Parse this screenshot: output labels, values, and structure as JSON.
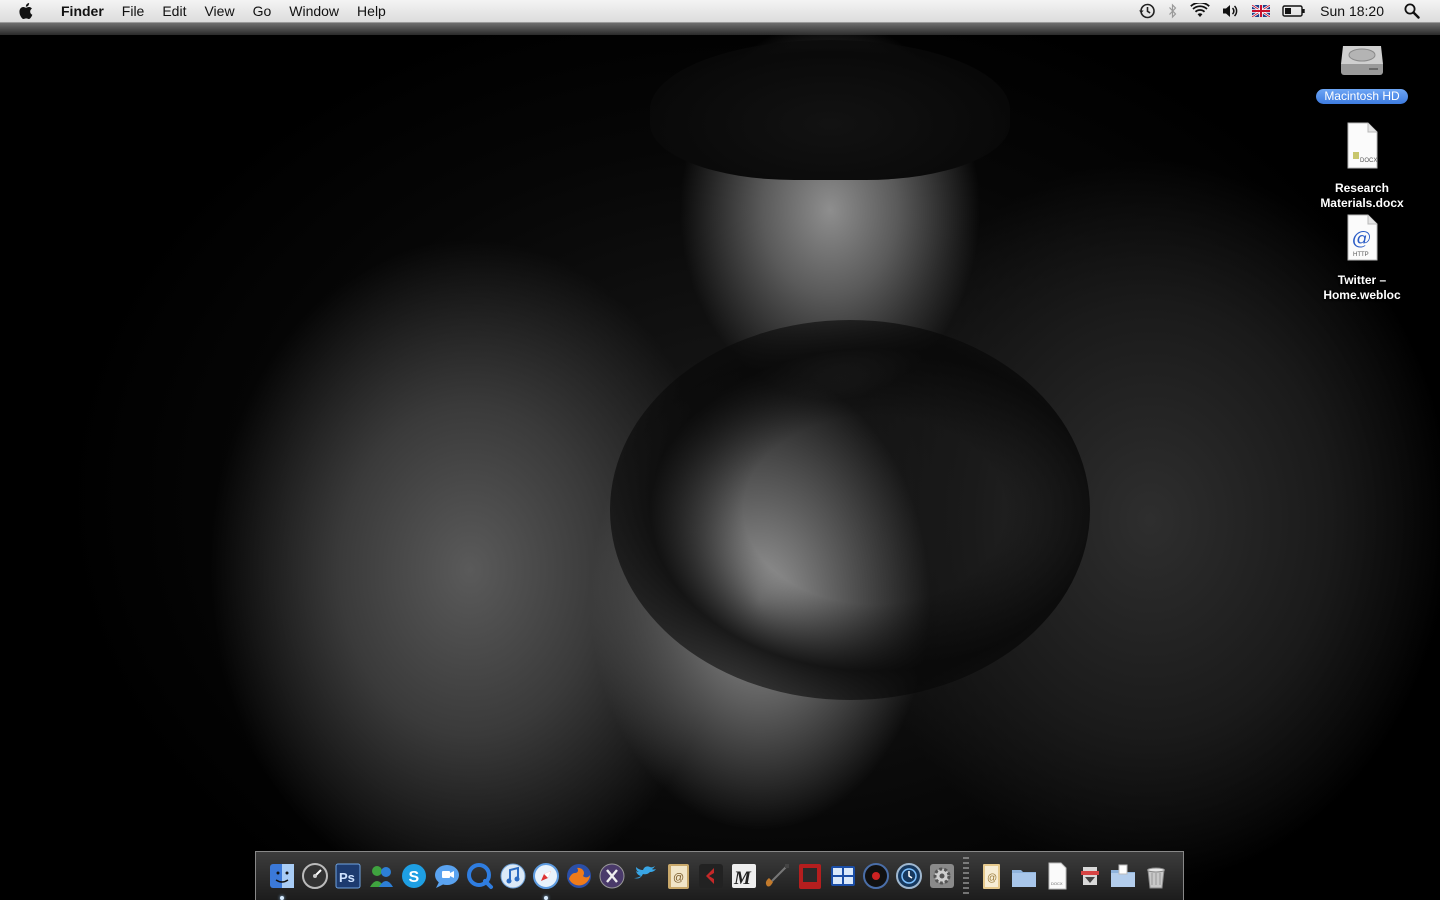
{
  "menubar": {
    "app_name": "Finder",
    "menus": [
      "File",
      "Edit",
      "View",
      "Go",
      "Window",
      "Help"
    ],
    "status_icons": [
      "time-machine-icon",
      "bluetooth-icon",
      "wifi-icon",
      "volume-icon",
      "uk-flag-icon",
      "battery-icon"
    ],
    "clock": "Sun 18:20"
  },
  "desktop_icons": [
    {
      "label": "Macintosh HD",
      "icon": "hard-drive-icon",
      "selected": true
    },
    {
      "label": "Research\nMaterials.docx",
      "icon": "docx-document-icon",
      "selected": false
    },
    {
      "label": "Twitter –\nHome.webloc",
      "icon": "webloc-http-icon",
      "selected": false
    }
  ],
  "dock": {
    "apps": [
      {
        "name": "finder-icon",
        "running": true
      },
      {
        "name": "dashboard-icon",
        "running": false
      },
      {
        "name": "photoshop-icon",
        "running": false,
        "text": "Ps"
      },
      {
        "name": "messenger-icon",
        "running": false
      },
      {
        "name": "skype-icon",
        "running": false
      },
      {
        "name": "ichat-icon",
        "running": false
      },
      {
        "name": "quicktime-icon",
        "running": false
      },
      {
        "name": "itunes-icon",
        "running": false
      },
      {
        "name": "safari-icon",
        "running": true
      },
      {
        "name": "firefox-icon",
        "running": false
      },
      {
        "name": "x11-icon",
        "running": false
      },
      {
        "name": "twitter-bird-icon",
        "running": false
      },
      {
        "name": "address-book-icon",
        "running": false
      },
      {
        "name": "filezilla-icon",
        "running": false
      },
      {
        "name": "mail-m-icon",
        "running": false,
        "text": "M"
      },
      {
        "name": "garageband-guitar-icon",
        "running": false
      },
      {
        "name": "photo-booth-icon",
        "running": false
      },
      {
        "name": "spaces-icon",
        "running": false
      },
      {
        "name": "dvd-player-icon",
        "running": false
      },
      {
        "name": "time-machine-icon",
        "running": false
      },
      {
        "name": "system-preferences-icon",
        "running": false
      }
    ],
    "stacks": [
      {
        "name": "address-stack-icon"
      },
      {
        "name": "folder-icon"
      },
      {
        "name": "docx-stack-icon"
      },
      {
        "name": "downloads-stack-icon"
      },
      {
        "name": "documents-folder-icon"
      },
      {
        "name": "trash-icon"
      }
    ],
    "colors": {
      "dot": "#d8ecff",
      "shelf": "#2a2a2a"
    }
  }
}
